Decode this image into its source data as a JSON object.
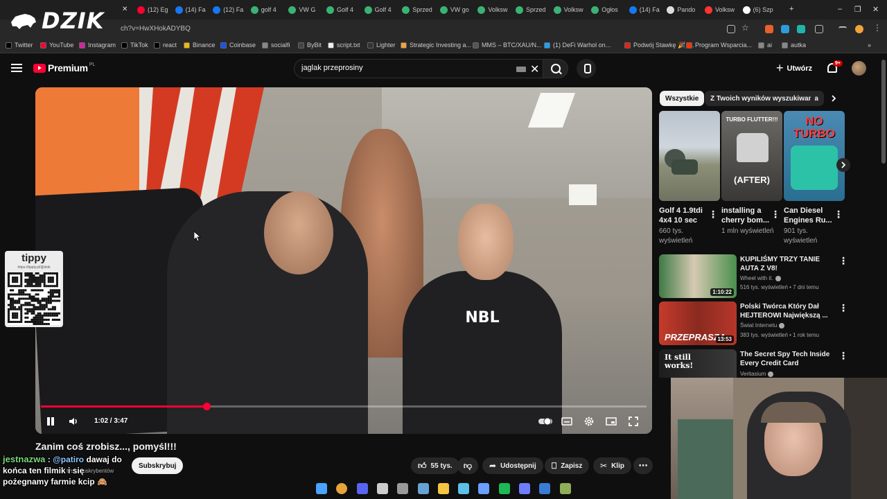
{
  "browser": {
    "tabs": [
      {
        "label": "(12) Eg",
        "color": "#ff0033"
      },
      {
        "label": "(14) Fa",
        "color": "#1877f2"
      },
      {
        "label": "(12) Fa",
        "color": "#1877f2"
      },
      {
        "label": "golf 4",
        "color": "#3bb273"
      },
      {
        "label": "VW G",
        "color": "#3bb273"
      },
      {
        "label": "Golf 4",
        "color": "#3bb273"
      },
      {
        "label": "Golf 4",
        "color": "#3bb273"
      },
      {
        "label": "Sprzed",
        "color": "#3bb273"
      },
      {
        "label": "VW go",
        "color": "#3bb273"
      },
      {
        "label": "Volksw",
        "color": "#3bb273"
      },
      {
        "label": "Sprzed",
        "color": "#3bb273"
      },
      {
        "label": "Volksw",
        "color": "#3bb273"
      },
      {
        "label": "Ogłos",
        "color": "#3bb273"
      },
      {
        "label": "(14) Fa",
        "color": "#1877f2"
      },
      {
        "label": "Pando",
        "color": "#dddddd"
      },
      {
        "label": "Volksw",
        "color": "#ff3333"
      },
      {
        "label": "(6) Szp",
        "color": "#ffffff"
      }
    ],
    "url": "ch?v=HwXHokADYBQ",
    "bookmarks": [
      "Twitter",
      "YouTube",
      "Instagram",
      "TikTok",
      "react",
      "Binance",
      "Coinbase",
      "socialfi",
      "ByBit",
      "script.txt",
      "Lighter",
      "Strategic Investing a...",
      "MMS – BTC/XAU/N...",
      "(1) DeFi Warhol on...",
      "Podwój Stawkę 🎉 |...",
      "Program Wsparcia...",
      "ai",
      "autka"
    ]
  },
  "overlay": {
    "logo_text": "DZIK",
    "tippy_title": "tippy",
    "tippy_url": "https://tipply.pl/@dzik"
  },
  "youtube": {
    "brand": "Premium",
    "country": "PL",
    "search_value": "jaglak przeprosiny",
    "create_label": "Utwórz",
    "notif_count": "9+"
  },
  "player": {
    "time": "1:02 / 3:47",
    "progress": 0.274
  },
  "video": {
    "title": "Zanim coś zrobisz..., pomyśl!!!",
    "subscribers": "96 tys. subskrybentów",
    "subscribe_label": "Subskrybuj",
    "likes": "55 tys.",
    "share_label": "Udostępnij",
    "save_label": "Zapisz",
    "clip_label": "Klip"
  },
  "chat": {
    "user": "jestnazwa",
    "mention": "@patiro",
    "line1_rest": "dawaj do",
    "line2": "końca ten filmik i się",
    "line3": "pożegnamy farmie kcip 🙈"
  },
  "chips": [
    "Wszystkie",
    "Z Twoich wyników wyszukiwania"
  ],
  "shorts": [
    {
      "title": "Golf 4 1.9tdi 4x4 10 sec",
      "views": "660 tys. wyświetleń",
      "overlay": ""
    },
    {
      "title": "installing a cherry bom...",
      "views": "1 mln wyświetleń",
      "overlay": "TURBO FLUTTER!!!",
      "overlay2": "(AFTER)"
    },
    {
      "title": "Can Diesel Engines Ru...",
      "views": "901 tys. wyświetleń",
      "overlay": "NO TURBO"
    }
  ],
  "related": [
    {
      "title": "KUPILIŚMY TRZY TANIE AUTA Z V8!",
      "channel": "Wheel with it.",
      "meta": "516 tys. wyświetleń • 7 dni temu",
      "duration": "1:10:22"
    },
    {
      "title": "Polski Twórca Który Dał HEJTEROWI Największą ...",
      "channel": "Świat Internetu",
      "meta": "383 tys. wyświetleń • 1 rok temu",
      "duration": "13:53",
      "overlay": "PRZEPRASZA"
    },
    {
      "title": "The Secret Spy Tech Inside Every Credit Card",
      "channel": "Veritasium",
      "meta": "",
      "duration": "",
      "overlay": "It still works!"
    }
  ],
  "colors": {
    "accent": "#ff0033",
    "background": "#0f0f0f"
  }
}
